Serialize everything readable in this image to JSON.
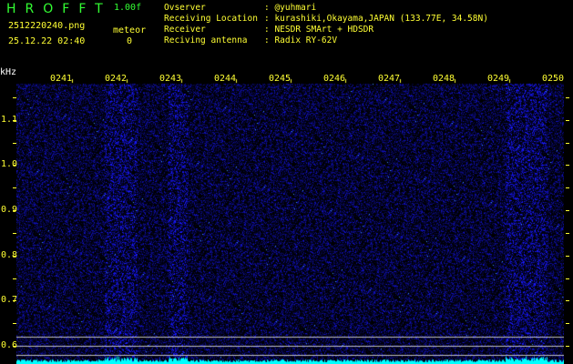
{
  "header": {
    "app_title": "HROFFT",
    "version": "1.00f",
    "filename": "2512220240.png",
    "datetime": "25.12.22 02:40",
    "meteor_label": "meteor",
    "meteor_count": "0",
    "info": [
      {
        "label": "Ovserver",
        "value": ": @yuhmari"
      },
      {
        "label": "Receiving Location",
        "value": ": kurashiki,Okayama,JAPAN (133.77E, 34.58N)"
      },
      {
        "label": "Receiver",
        "value": ": NESDR SMArt + HDSDR"
      },
      {
        "label": "Reciving antenna",
        "value": ": Radix RY-62V"
      }
    ]
  },
  "colors": {
    "text": "#ffff33",
    "title": "#33ff33",
    "signal": "#2020ff",
    "baseline": "#00ffff",
    "guide": "#c0c0c0"
  },
  "chart_data": {
    "type": "heatmap",
    "ylabel": "kHz",
    "y_ticks": [
      "1.1",
      "1.0",
      "0.9",
      "0.8",
      "0.7",
      "0.6"
    ],
    "y_tick_values": [
      1.1,
      1.0,
      0.9,
      0.8,
      0.7,
      0.6
    ],
    "ylim": [
      0.56,
      1.18
    ],
    "x_ticks": [
      "0241",
      "0242",
      "0243",
      "0244",
      "0245",
      "0246",
      "0247",
      "0248",
      "0249",
      "0250"
    ],
    "guide_lines_khz": [
      0.62,
      0.6,
      0.58
    ],
    "bright_bands_minutes": [
      [
        "0241.6",
        "0242.2"
      ],
      [
        "0242.8",
        "0243.1"
      ],
      [
        "0249.1",
        "0249.8"
      ]
    ]
  }
}
